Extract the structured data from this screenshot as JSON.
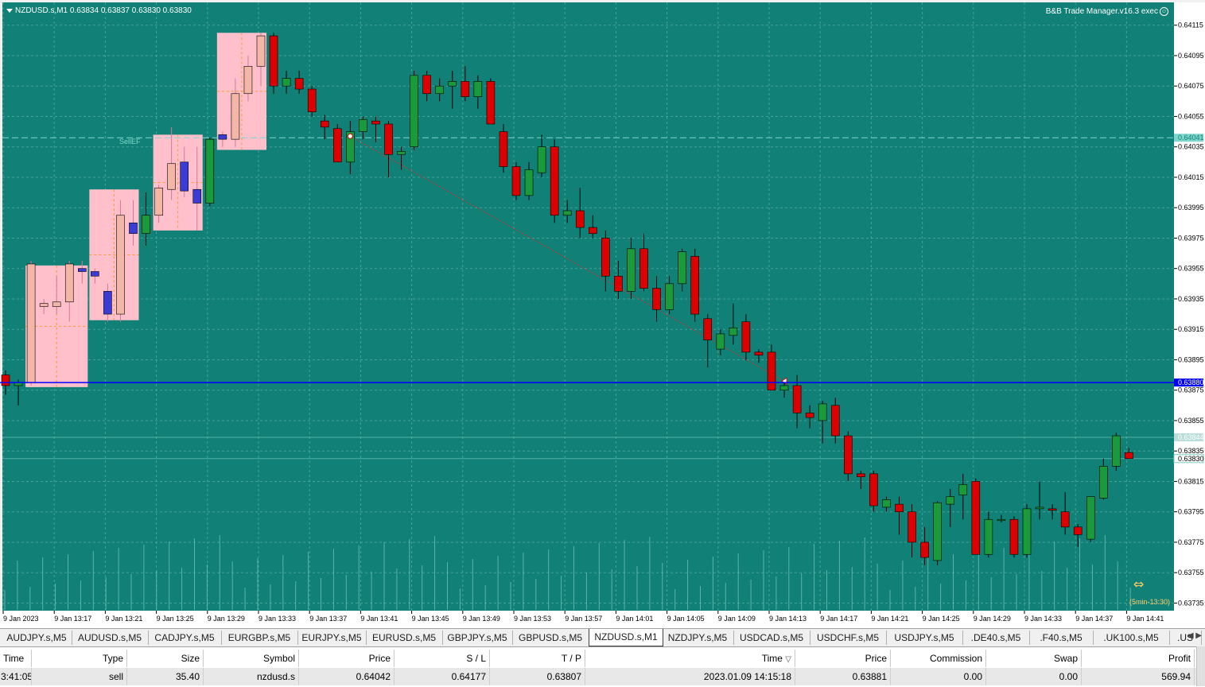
{
  "chart": {
    "symbol_line": "NZDUSD.s,M1  0.63834 0.63837 0.63830 0.63830",
    "ea_label": "B&B Trade Manager.v16.3 exec",
    "zone_label": "SellEF",
    "session_label": "(5min-13:30)",
    "colors": {
      "background": "#118076",
      "grid": "#5fb0a8",
      "bull": "#1a9a3a",
      "bear": "#dd0000",
      "zone": "#ffc0cb",
      "hline": "#0000ff",
      "axis_bg": "#ffffff"
    },
    "price_axis_labels": [
      "0.64115",
      "0.64095",
      "0.64075",
      "0.64055",
      "0.64035",
      "0.64015",
      "0.63995",
      "0.63975",
      "0.63955",
      "0.63935",
      "0.63915",
      "0.63895",
      "0.63875",
      "0.63855",
      "0.63835",
      "0.63815",
      "0.63795",
      "0.63775",
      "0.63755",
      "0.63735"
    ],
    "price_tags": [
      {
        "label": "0.64041",
        "value": 0.64041,
        "style": "dashed"
      },
      {
        "label": "0.63880",
        "value": 0.6388,
        "style": "blue"
      },
      {
        "label": "0.63844",
        "value": 0.63844,
        "style": "faint"
      },
      {
        "label": "0.63830",
        "value": 0.6383,
        "style": "current"
      }
    ],
    "time_axis_labels": [
      "9 Jan 2023",
      "9 Jan 13:17",
      "9 Jan 13:21",
      "9 Jan 13:25",
      "9 Jan 13:29",
      "9 Jan 13:33",
      "9 Jan 13:37",
      "9 Jan 13:41",
      "9 Jan 13:45",
      "9 Jan 13:49",
      "9 Jan 13:53",
      "9 Jan 13:57",
      "9 Jan 14:01",
      "9 Jan 14:05",
      "9 Jan 14:09",
      "9 Jan 14:13",
      "9 Jan 14:17",
      "9 Jan 14:21",
      "9 Jan 14:25",
      "9 Jan 14:29",
      "9 Jan 14:33",
      "9 Jan 14:37",
      "9 Jan 14:41"
    ]
  },
  "chart_data": {
    "type": "candlestick",
    "y_range": [
      0.6373,
      0.6413
    ],
    "candles": [
      [
        0.63885,
        0.63888,
        0.63872,
        0.63878
      ],
      [
        0.63878,
        0.63882,
        0.63865,
        0.6388
      ],
      [
        0.6388,
        0.6396,
        0.63878,
        0.63958
      ],
      [
        0.6393,
        0.63935,
        0.63925,
        0.63932
      ],
      [
        0.6393,
        0.6395,
        0.63925,
        0.63933
      ],
      [
        0.63933,
        0.6396,
        0.6392,
        0.63958
      ],
      [
        0.63955,
        0.6396,
        0.63945,
        0.63953
      ],
      [
        0.63953,
        0.63955,
        0.63945,
        0.6395
      ],
      [
        0.6394,
        0.63945,
        0.6392,
        0.63925
      ],
      [
        0.63925,
        0.64,
        0.6392,
        0.6399
      ],
      [
        0.63985,
        0.64,
        0.6397,
        0.63978
      ],
      [
        0.63978,
        0.64005,
        0.6397,
        0.6399
      ],
      [
        0.6399,
        0.6401,
        0.63985,
        0.64008
      ],
      [
        0.64007,
        0.64048,
        0.64,
        0.64024
      ],
      [
        0.64025,
        0.64035,
        0.64002,
        0.64006
      ],
      [
        0.64007,
        0.64035,
        0.6398,
        0.63998
      ],
      [
        0.63998,
        0.64041,
        0.63996,
        0.6404
      ],
      [
        0.64043,
        0.64045,
        0.64035,
        0.6404
      ],
      [
        0.6404,
        0.6408,
        0.64035,
        0.6407
      ],
      [
        0.6407,
        0.64095,
        0.64065,
        0.64088
      ],
      [
        0.64088,
        0.6411,
        0.64075,
        0.64108
      ],
      [
        0.64108,
        0.6411,
        0.6407,
        0.64075
      ],
      [
        0.64075,
        0.64085,
        0.6407,
        0.6408
      ],
      [
        0.6408,
        0.64085,
        0.6407,
        0.64073
      ],
      [
        0.64073,
        0.64075,
        0.64055,
        0.64058
      ],
      [
        0.64052,
        0.64056,
        0.6404,
        0.64048
      ],
      [
        0.64047,
        0.6405,
        0.64025,
        0.64025
      ],
      [
        0.64025,
        0.64052,
        0.64017,
        0.64045
      ],
      [
        0.64045,
        0.64055,
        0.6404,
        0.64053
      ],
      [
        0.64052,
        0.64055,
        0.64038,
        0.6405
      ],
      [
        0.6405,
        0.64052,
        0.64015,
        0.6403
      ],
      [
        0.6403,
        0.64035,
        0.6402,
        0.64032
      ],
      [
        0.64035,
        0.64085,
        0.64033,
        0.64082
      ],
      [
        0.64082,
        0.64085,
        0.64065,
        0.6407
      ],
      [
        0.6407,
        0.6408,
        0.64065,
        0.64075
      ],
      [
        0.64075,
        0.64085,
        0.6406,
        0.64078
      ],
      [
        0.64078,
        0.64088,
        0.64065,
        0.64068
      ],
      [
        0.64068,
        0.64082,
        0.6406,
        0.64078
      ],
      [
        0.64078,
        0.6408,
        0.6405,
        0.6405
      ],
      [
        0.64045,
        0.6405,
        0.64018,
        0.64022
      ],
      [
        0.64022,
        0.64025,
        0.64,
        0.64003
      ],
      [
        0.64003,
        0.64025,
        0.64,
        0.6402
      ],
      [
        0.64018,
        0.64043,
        0.64015,
        0.64035
      ],
      [
        0.64035,
        0.6404,
        0.63985,
        0.6399
      ],
      [
        0.6399,
        0.64,
        0.63985,
        0.63993
      ],
      [
        0.63993,
        0.64008,
        0.63975,
        0.63982
      ],
      [
        0.63982,
        0.6399,
        0.63975,
        0.63978
      ],
      [
        0.63975,
        0.6398,
        0.6394,
        0.6395
      ],
      [
        0.6395,
        0.6396,
        0.63935,
        0.6394
      ],
      [
        0.6394,
        0.63975,
        0.63935,
        0.63968
      ],
      [
        0.63968,
        0.63978,
        0.6394,
        0.63942
      ],
      [
        0.63942,
        0.6395,
        0.6392,
        0.63928
      ],
      [
        0.63928,
        0.6395,
        0.63925,
        0.63945
      ],
      [
        0.63945,
        0.63968,
        0.6394,
        0.63966
      ],
      [
        0.63963,
        0.63968,
        0.6392,
        0.63925
      ],
      [
        0.63922,
        0.63925,
        0.6389,
        0.63908
      ],
      [
        0.63902,
        0.63915,
        0.63898,
        0.63912
      ],
      [
        0.63911,
        0.63932,
        0.63905,
        0.63916
      ],
      [
        0.6392,
        0.63925,
        0.63895,
        0.639
      ],
      [
        0.639,
        0.63902,
        0.63893,
        0.63898
      ],
      [
        0.639,
        0.63905,
        0.63878,
        0.63875
      ],
      [
        0.63875,
        0.6388,
        0.6387,
        0.63878
      ],
      [
        0.63878,
        0.63885,
        0.6385,
        0.6386
      ],
      [
        0.6386,
        0.63865,
        0.6385,
        0.63857
      ],
      [
        0.63855,
        0.63868,
        0.6384,
        0.63866
      ],
      [
        0.63865,
        0.6387,
        0.6384,
        0.63845
      ],
      [
        0.63845,
        0.63848,
        0.63815,
        0.6382
      ],
      [
        0.6382,
        0.63822,
        0.6381,
        0.63818
      ],
      [
        0.6382,
        0.63822,
        0.63795,
        0.63799
      ],
      [
        0.63798,
        0.63805,
        0.63795,
        0.63803
      ],
      [
        0.638,
        0.63805,
        0.6378,
        0.63795
      ],
      [
        0.63795,
        0.638,
        0.63765,
        0.63775
      ],
      [
        0.63775,
        0.63785,
        0.6376,
        0.63765
      ],
      [
        0.63763,
        0.63802,
        0.6376,
        0.63801
      ],
      [
        0.638,
        0.6381,
        0.63785,
        0.63805
      ],
      [
        0.63806,
        0.6382,
        0.6379,
        0.63813
      ],
      [
        0.63815,
        0.63817,
        0.63768,
        0.63767
      ],
      [
        0.63767,
        0.63795,
        0.63765,
        0.6379
      ],
      [
        0.6379,
        0.63793,
        0.63788,
        0.6379
      ],
      [
        0.6379,
        0.63792,
        0.63765,
        0.63767
      ],
      [
        0.63767,
        0.638,
        0.63765,
        0.63797
      ],
      [
        0.63797,
        0.63815,
        0.6379,
        0.63798
      ],
      [
        0.63797,
        0.638,
        0.6379,
        0.63796
      ],
      [
        0.63795,
        0.63808,
        0.6378,
        0.63785
      ],
      [
        0.63785,
        0.63787,
        0.63772,
        0.6378
      ],
      [
        0.63777,
        0.63805,
        0.63775,
        0.63805
      ],
      [
        0.63804,
        0.6383,
        0.63803,
        0.63825
      ],
      [
        0.63825,
        0.63847,
        0.63822,
        0.63845
      ],
      [
        0.63834,
        0.63837,
        0.6383,
        0.6383
      ]
    ],
    "horizontal_line": 0.6388,
    "zones": [
      {
        "candles": [
          2,
          6
        ],
        "low": 0.63877,
        "high": 0.63957
      },
      {
        "candles": [
          7,
          10
        ],
        "low": 0.63921,
        "high": 0.64007
      },
      {
        "candles": [
          12,
          15
        ],
        "low": 0.6398,
        "high": 0.64043
      },
      {
        "candles": [
          17,
          20
        ],
        "low": 0.64033,
        "high": 0.6411
      }
    ]
  },
  "tabs": [
    "AUDJPY.s,M5",
    "AUDUSD.s,M5",
    "CADJPY.s,M5",
    "EURGBP.s,M5",
    "EURJPY.s,M5",
    "EURUSD.s,M5",
    "GBPJPY.s,M5",
    "GBPUSD.s,M5",
    "NZDUSD.s,M1",
    "NZDJPY.s,M5",
    "USDCAD.s,M5",
    "USDCHF.s,M5",
    "USDJPY.s,M5",
    ".DE40.s,M5",
    ".F40.s,M5",
    ".UK100.s,M5",
    ".US"
  ],
  "active_tab": "NZDUSD.s,M1",
  "tab_arrows": "◀ ▶",
  "terminal": {
    "headers": {
      "time": "Time",
      "type": "Type",
      "size": "Size",
      "symbol": "Symbol",
      "price": "Price",
      "sl": "S / L",
      "tp": "T / P",
      "time2": "Time",
      "price2": "Price",
      "commission": "Commission",
      "swap": "Swap",
      "profit": "Profit"
    },
    "sort_indicator": "▽",
    "row": {
      "time": "3:41:05",
      "type": "sell",
      "size": "35.40",
      "symbol": "nzdusd.s",
      "price": "0.64042",
      "sl": "0.64177",
      "tp": "0.63807",
      "time2": "2023.01.09 14:15:18",
      "price2": "0.63881",
      "commission": "0.00",
      "swap": "0.00",
      "profit": "569.94"
    }
  }
}
